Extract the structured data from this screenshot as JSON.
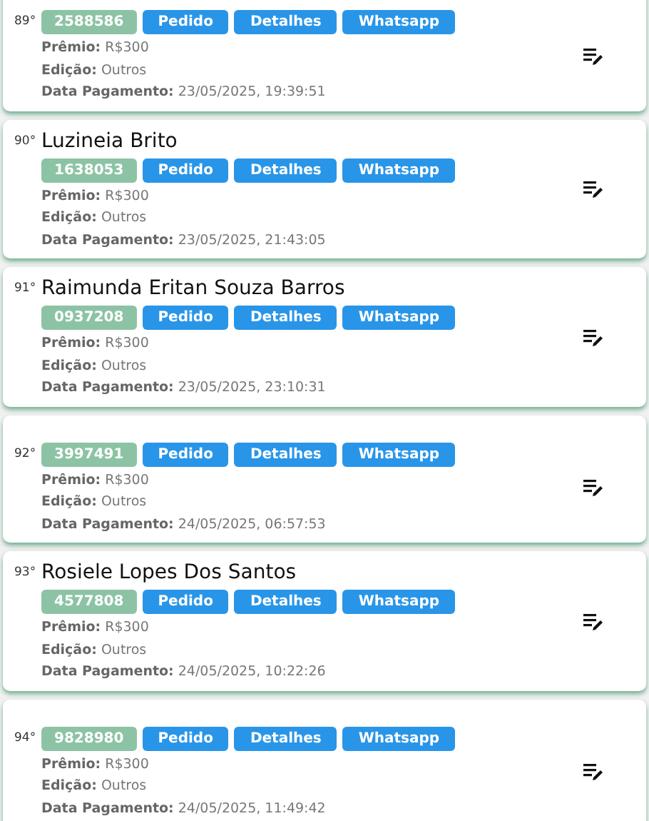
{
  "entries": [
    {
      "rank": "89°",
      "code": "2588586",
      "buttons": [
        "Pedido",
        "Detalhes",
        "Whatsapp"
      ],
      "fields": [
        {
          "label": "Prêmio:",
          "value": "R$300"
        },
        {
          "label": "Edição:",
          "value": "Outros"
        },
        {
          "label": "Data Pagamento:",
          "value": "23/05/2025, 19:39:51"
        }
      ]
    },
    {
      "rank": "90°",
      "name": "Luzineia Brito",
      "code": "1638053",
      "buttons": [
        "Pedido",
        "Detalhes",
        "Whatsapp"
      ],
      "fields": [
        {
          "label": "Prêmio:",
          "value": "R$300"
        },
        {
          "label": "Edição:",
          "value": "Outros"
        },
        {
          "label": "Data Pagamento:",
          "value": "23/05/2025, 21:43:05"
        }
      ]
    },
    {
      "rank": "91°",
      "name": "Raimunda Eritan Souza Barros",
      "code": "0937208",
      "buttons": [
        "Pedido",
        "Detalhes",
        "Whatsapp"
      ],
      "fields": [
        {
          "label": "Prêmio:",
          "value": "R$300"
        },
        {
          "label": "Edição:",
          "value": "Outros"
        },
        {
          "label": "Data Pagamento:",
          "value": "23/05/2025, 23:10:31"
        }
      ]
    },
    {
      "rank": "92°",
      "code": "3997491",
      "buttons": [
        "Pedido",
        "Detalhes",
        "Whatsapp"
      ],
      "fields": [
        {
          "label": "Prêmio:",
          "value": "R$300"
        },
        {
          "label": "Edição:",
          "value": "Outros"
        },
        {
          "label": "Data Pagamento:",
          "value": "24/05/2025, 06:57:53"
        }
      ]
    },
    {
      "rank": "93°",
      "name": "Rosiele Lopes Dos Santos",
      "code": "4577808",
      "buttons": [
        "Pedido",
        "Detalhes",
        "Whatsapp"
      ],
      "fields": [
        {
          "label": "Prêmio:",
          "value": "R$300"
        },
        {
          "label": "Edição:",
          "value": "Outros"
        },
        {
          "label": "Data Pagamento:",
          "value": "24/05/2025, 10:22:26"
        }
      ]
    },
    {
      "rank": "94°",
      "code": "9828980",
      "buttons": [
        "Pedido",
        "Detalhes",
        "Whatsapp"
      ],
      "fields": [
        {
          "label": "Prêmio:",
          "value": "R$300"
        },
        {
          "label": "Edição:",
          "value": "Outros"
        },
        {
          "label": "Data Pagamento:",
          "value": "24/05/2025, 11:49:42"
        }
      ]
    }
  ]
}
